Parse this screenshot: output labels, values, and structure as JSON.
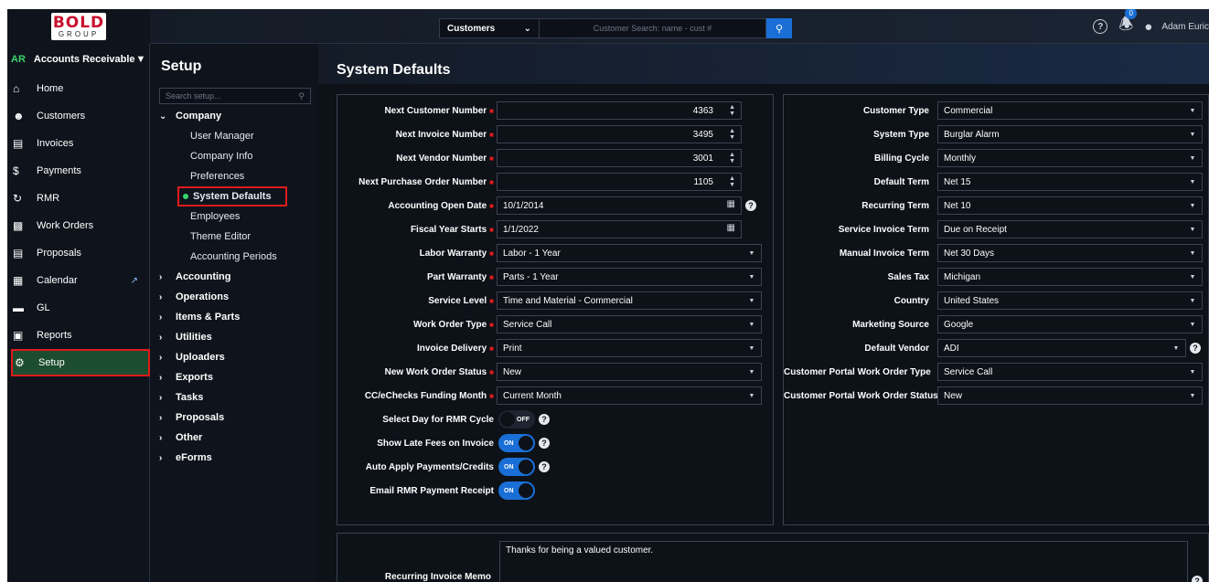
{
  "brand": {
    "logo_main": "BOLD",
    "logo_sub": "GROUP"
  },
  "topbar": {
    "search_scope": "Customers",
    "search_placeholder": "Customer Search: name - cust #",
    "notification_count": "0",
    "user_name": "Adam Euric"
  },
  "leftnav": {
    "module_tag": "AR",
    "module_title": "Accounts Receivable",
    "items": [
      {
        "label": "Home",
        "icon": "home-icon"
      },
      {
        "label": "Customers",
        "icon": "user-icon"
      },
      {
        "label": "Invoices",
        "icon": "invoice-icon"
      },
      {
        "label": "Payments",
        "icon": "dollar-icon"
      },
      {
        "label": "RMR",
        "icon": "refresh-icon"
      },
      {
        "label": "Work Orders",
        "icon": "clipboard-icon"
      },
      {
        "label": "Proposals",
        "icon": "document-icon"
      },
      {
        "label": "Calendar",
        "icon": "calendar-icon"
      },
      {
        "label": "GL",
        "icon": "card-icon"
      },
      {
        "label": "Reports",
        "icon": "reports-icon"
      },
      {
        "label": "Setup",
        "icon": "gear-icon"
      }
    ]
  },
  "setup": {
    "title": "Setup",
    "search_placeholder": "Search setup...",
    "company_label": "Company",
    "company_children": [
      "User Manager",
      "Company Info",
      "Preferences",
      "System Defaults",
      "Employees",
      "Theme Editor",
      "Accounting Periods"
    ],
    "sections": [
      "Accounting",
      "Operations",
      "Items & Parts",
      "Utilities",
      "Uploaders",
      "Exports",
      "Tasks",
      "Proposals",
      "Other",
      "eForms"
    ]
  },
  "main": {
    "title": "System Defaults",
    "left_fields": [
      {
        "label": "Next Customer Number",
        "value": "4363"
      },
      {
        "label": "Next Invoice Number",
        "value": "3495"
      },
      {
        "label": "Next Vendor Number",
        "value": "3001"
      },
      {
        "label": "Next Purchase Order Number",
        "value": "1105"
      },
      {
        "label": "Accounting Open Date",
        "value": "10/1/2014"
      },
      {
        "label": "Fiscal Year Starts",
        "value": "1/1/2022"
      },
      {
        "label": "Labor Warranty",
        "value": "Labor - 1 Year"
      },
      {
        "label": "Part Warranty",
        "value": "Parts - 1 Year"
      },
      {
        "label": "Service Level",
        "value": "Time and Material - Commercial"
      },
      {
        "label": "Work Order Type",
        "value": "Service Call"
      },
      {
        "label": "Invoice Delivery",
        "value": "Print"
      },
      {
        "label": "New Work Order Status",
        "value": "New"
      },
      {
        "label": "CC/eChecks Funding Month",
        "value": "Current Month"
      }
    ],
    "toggles": [
      {
        "label": "Select Day for RMR Cycle",
        "state": "OFF"
      },
      {
        "label": "Show Late Fees on Invoice",
        "state": "ON"
      },
      {
        "label": "Auto Apply Payments/Credits",
        "state": "ON"
      },
      {
        "label": "Email RMR Payment Receipt",
        "state": "ON"
      }
    ],
    "right_fields": [
      {
        "label": "Customer Type",
        "value": "Commercial"
      },
      {
        "label": "System Type",
        "value": "Burglar Alarm"
      },
      {
        "label": "Billing Cycle",
        "value": "Monthly"
      },
      {
        "label": "Default Term",
        "value": "Net 15"
      },
      {
        "label": "Recurring Term",
        "value": "Net 10"
      },
      {
        "label": "Service Invoice Term",
        "value": "Due on Receipt"
      },
      {
        "label": "Manual Invoice Term",
        "value": "Net 30 Days"
      },
      {
        "label": "Sales Tax",
        "value": "Michigan"
      },
      {
        "label": "Country",
        "value": "United States"
      },
      {
        "label": "Marketing Source",
        "value": "Google"
      },
      {
        "label": "Default Vendor",
        "value": "ADI"
      },
      {
        "label": "Customer Portal Work Order Type",
        "value": "Service Call"
      },
      {
        "label": "Customer Portal Work Order Status",
        "value": "New"
      }
    ],
    "memo": {
      "label": "Recurring Invoice Memo",
      "value": "Thanks for being a valued customer."
    }
  }
}
